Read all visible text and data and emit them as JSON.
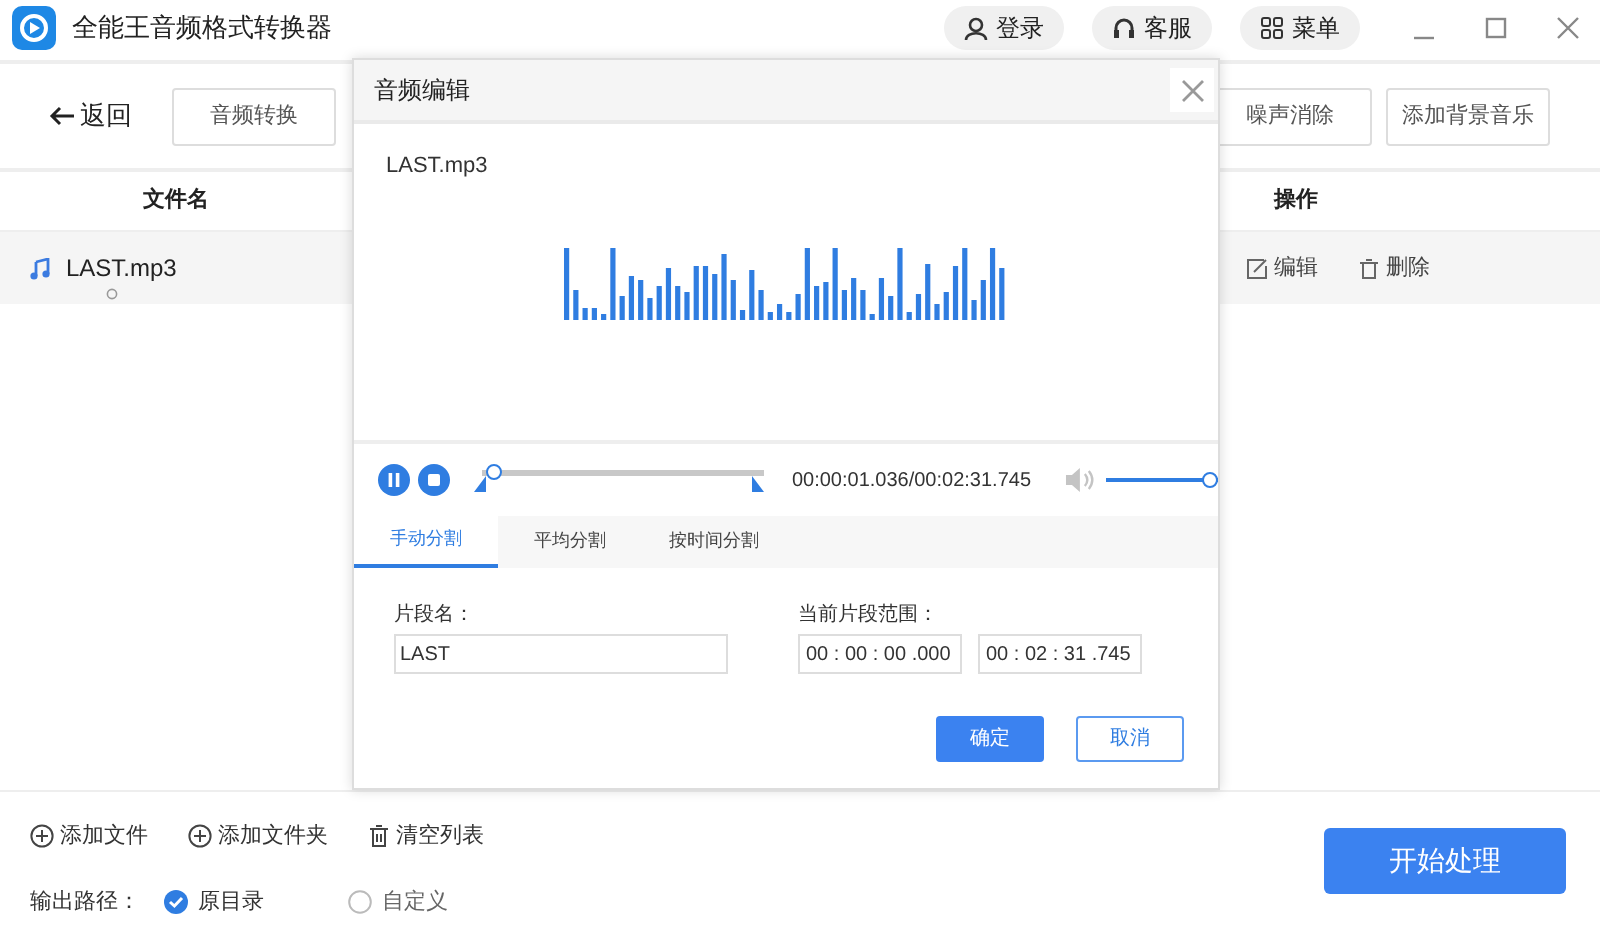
{
  "app": {
    "title": "全能王音频格式转换器"
  },
  "header_buttons": [
    {
      "label": "登录",
      "kind": "user"
    },
    {
      "label": "客服",
      "kind": "headset"
    },
    {
      "label": "菜单",
      "kind": "grid"
    }
  ],
  "toolbar": {
    "back": "返回",
    "tools_left": [
      "音频转换"
    ],
    "tools_right": [
      "噪声消除",
      "添加背景音乐"
    ]
  },
  "table": {
    "columns": [
      "文件名",
      "操作"
    ],
    "rows": [
      {
        "name": "LAST.mp3",
        "actions": [
          {
            "label": "编辑",
            "kind": "edit"
          },
          {
            "label": "删除",
            "kind": "delete"
          }
        ]
      }
    ]
  },
  "file_actions": [
    {
      "label": "添加文件",
      "kind": "add"
    },
    {
      "label": "添加文件夹",
      "kind": "add"
    },
    {
      "label": "清空列表",
      "kind": "trash"
    }
  ],
  "output": {
    "label": "输出路径：",
    "options": [
      {
        "label": "原目录",
        "selected": true
      },
      {
        "label": "自定义",
        "selected": false
      }
    ]
  },
  "start_button": "开始处理",
  "dialog": {
    "title": "音频编辑",
    "file": "LAST.mp3",
    "playing": true,
    "position": {
      "level": 0.04
    },
    "time": "00:00:01.036/00:02:31.745",
    "volume": {
      "level": 1
    },
    "tabs": [
      {
        "label": "手动分割",
        "selected": true
      },
      {
        "label": "平均分割",
        "selected": false
      },
      {
        "label": "按时间分割",
        "selected": false
      }
    ],
    "name_label": "片段名：",
    "name_value": "LAST",
    "range_label": "当前片段范围：",
    "range_start": "00 : 00 : 00 .000",
    "range_end": "00 : 02 : 31 .745",
    "buttons": [
      {
        "label": "确定",
        "kind": "primary"
      },
      {
        "label": "取消",
        "kind": "secondary"
      }
    ]
  }
}
